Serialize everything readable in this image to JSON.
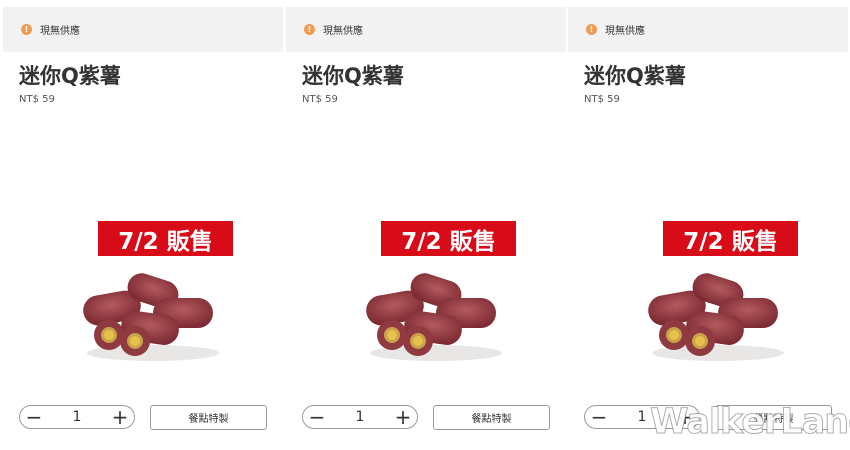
{
  "panels": [
    {
      "notice": {
        "icon": "exclamation-icon",
        "text": "現無供應"
      },
      "product": {
        "name": "迷你Q紫薯",
        "price": "NT$ 59",
        "sale_badge": "7/2 販售"
      },
      "quantity": {
        "value": "1",
        "minus": "−",
        "plus": "+"
      },
      "customize_label": "餐點特製"
    },
    {
      "notice": {
        "icon": "exclamation-icon",
        "text": "現無供應"
      },
      "product": {
        "name": "迷你Q紫薯",
        "price": "NT$ 59",
        "sale_badge": "7/2 販售"
      },
      "quantity": {
        "value": "1",
        "minus": "−",
        "plus": "+"
      },
      "customize_label": "餐點特製"
    },
    {
      "notice": {
        "icon": "exclamation-icon",
        "text": "現無供應"
      },
      "product": {
        "name": "迷你Q紫薯",
        "price": "NT$ 59",
        "sale_badge": "7/2 販售"
      },
      "quantity": {
        "value": "1",
        "minus": "−",
        "plus": "+"
      },
      "customize_label": "餐點特製"
    }
  ],
  "watermark": "WalkerLand",
  "colors": {
    "notice_bg": "#f2f2f2",
    "notice_icon": "#ef9b51",
    "sale_badge_bg": "#d80c18",
    "border": "#9a9a9a"
  }
}
